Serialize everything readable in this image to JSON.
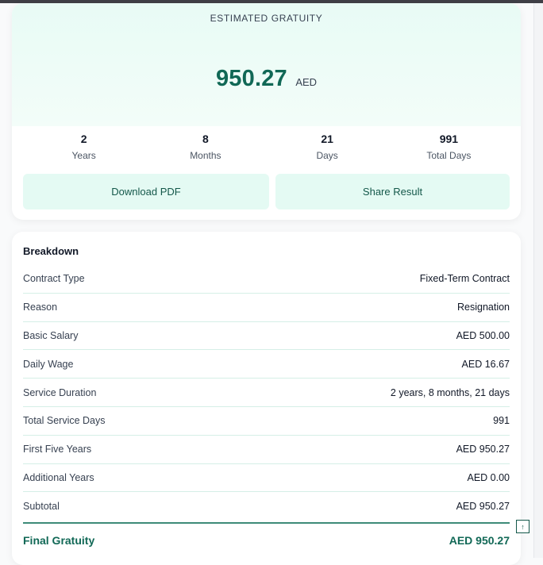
{
  "result": {
    "title": "ESTIMATED GRATUITY",
    "amount": "950.27",
    "currency": "AED",
    "stats": [
      {
        "value": "2",
        "label": "Years"
      },
      {
        "value": "8",
        "label": "Months"
      },
      {
        "value": "21",
        "label": "Days"
      },
      {
        "value": "991",
        "label": "Total Days"
      }
    ],
    "actions": {
      "download_label": "Download PDF",
      "share_label": "Share Result"
    }
  },
  "breakdown": {
    "title": "Breakdown",
    "rows": [
      {
        "label": "Contract Type",
        "value": "Fixed-Term Contract"
      },
      {
        "label": "Reason",
        "value": "Resignation"
      },
      {
        "label": "Basic Salary",
        "value": "AED 500.00"
      },
      {
        "label": "Daily Wage",
        "value": "AED 16.67"
      },
      {
        "label": "Service Duration",
        "value": "2 years, 8 months, 21 days"
      },
      {
        "label": "Total Service Days",
        "value": "991"
      },
      {
        "label": "First Five Years",
        "value": "AED 950.27"
      },
      {
        "label": "Additional Years",
        "value": "AED 0.00"
      },
      {
        "label": "Subtotal",
        "value": "AED 950.27"
      }
    ],
    "final": {
      "label": "Final Gratuity",
      "value": "AED 950.27"
    }
  },
  "icons": {
    "scroll_top": "arrow-up-icon"
  },
  "colors": {
    "accent": "#116856",
    "accent_light": "#e4faf3",
    "divider": "#d5efe7"
  }
}
